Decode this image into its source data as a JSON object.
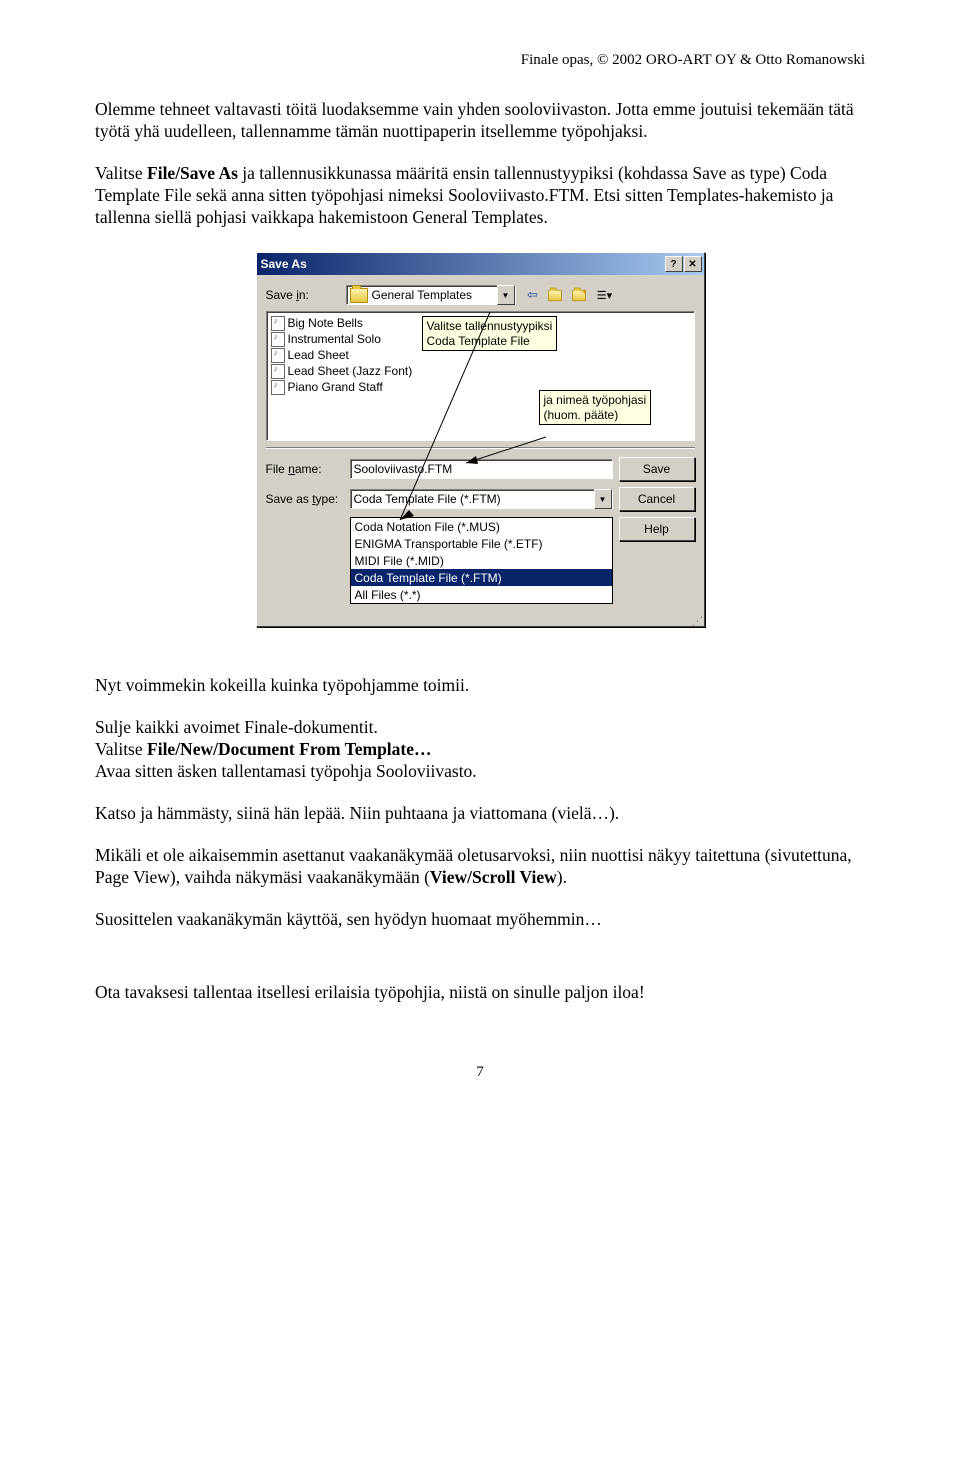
{
  "header_right": "Finale opas, © 2002 ORO-ART OY & Otto Romanowski",
  "para1": "Olemme tehneet valtavasti töitä luodaksemme vain yhden sooloviivaston. Jotta emme joutuisi tekemään tätä työtä yhä uudelleen, tallennamme tämän nuottipaperin itsellemme työpohjaksi.",
  "para2_a": "Valitse ",
  "para2_b_bold": "File/Save As",
  "para2_c": " ja tallennusikkunassa määritä ensin tallennustyypiksi (kohdassa Save as type) Coda Template File sekä anna sitten työpohjasi nimeksi Sooloviivasto.FTM. Etsi sitten Templates-hakemisto ja tallenna siellä pohjasi vaikkapa hakemistoon General Templates.",
  "dialog": {
    "title": "Save As",
    "savein_label": "Save in:",
    "savein_value": "General Templates",
    "files": [
      "Big Note Bells",
      "Instrumental Solo",
      "Lead Sheet",
      "Lead Sheet (Jazz Font)",
      "Piano Grand Staff"
    ],
    "tooltip1_l1": "Valitse tallennustyypiksi",
    "tooltip1_l2": "Coda Template File",
    "tooltip2_l1": "ja nimeä työpohjasi",
    "tooltip2_l2": "(huom. pääte)",
    "filename_label": "File name:",
    "filename_value": "Sooloviivasto.FTM",
    "saveastype_label": "Save as type:",
    "saveastype_value": "Coda Template File (*.FTM)",
    "type_options": [
      "Coda Notation File (*.MUS)",
      "ENIGMA Transportable File (*.ETF)",
      "MIDI File (*.MID)",
      "Coda Template File (*.FTM)",
      "All Files (*.*)"
    ],
    "btn_save": "Save",
    "btn_cancel": "Cancel",
    "btn_help": "Help"
  },
  "para3": "Nyt voimmekin kokeilla kuinka työpohjamme toimii.",
  "para4_l1": "Sulje kaikki avoimet Finale-dokumentit.",
  "para4_l2a": "Valitse ",
  "para4_l2b_bold": "File/New/Document From Template…",
  "para4_l3": "Avaa sitten äsken tallentamasi työpohja Sooloviivasto.",
  "para5": "Katso ja hämmästy, siinä hän lepää. Niin puhtaana ja viattomana (vielä…).",
  "para6_a": "Mikäli et ole aikaisemmin asettanut vaakanäkymää oletusarvoksi, niin nuottisi näkyy taitettuna (sivutettuna, Page View), vaihda näkymäsi vaakanäkymään (",
  "para6_b_bold": "View/Scroll View",
  "para6_c": ").",
  "para7": "Suosittelen vaakanäkymän käyttöä, sen hyödyn huomaat myöhemmin…",
  "para8": "Ota tavaksesi tallentaa itsellesi erilaisia työpohjia, niistä on sinulle paljon iloa!",
  "page_number": "7"
}
